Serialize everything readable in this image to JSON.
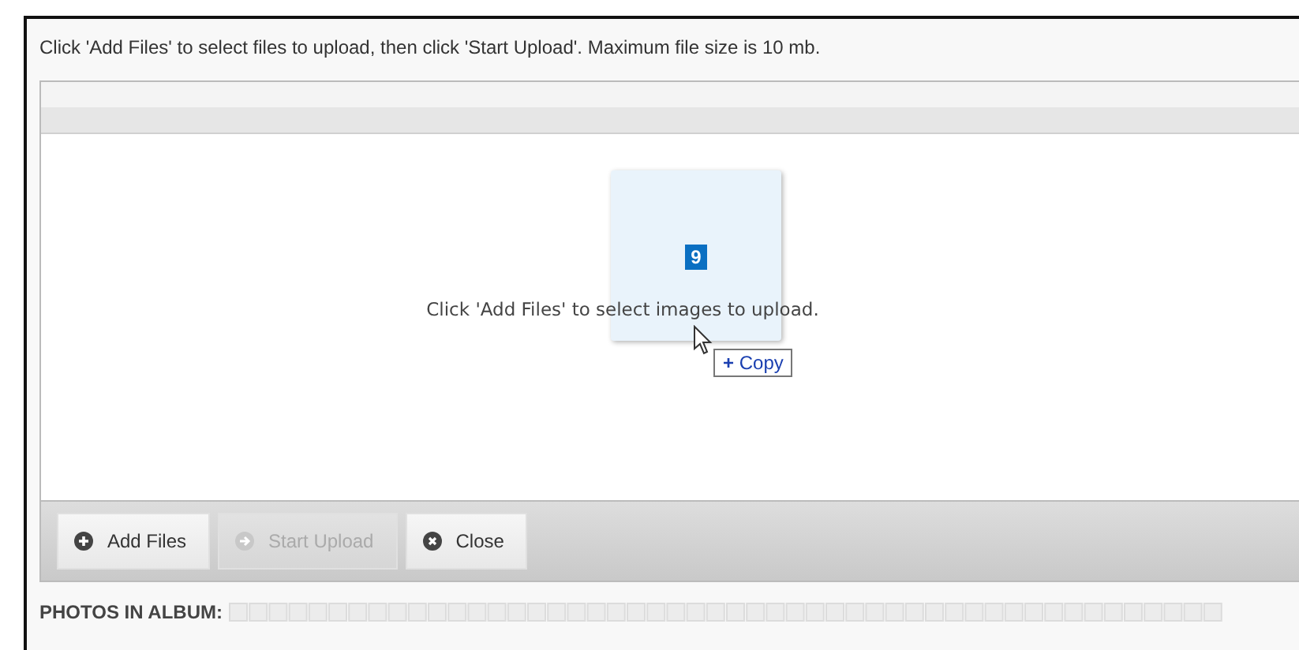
{
  "instructions": "Click 'Add Files' to select files to upload, then click 'Start Upload'. Maximum file size is 10 mb.",
  "drop_area": {
    "message": "Click 'Add Files' to select images to upload.",
    "drag_badge": "9",
    "drag_tooltip": {
      "symbol": "+",
      "label": "Copy"
    }
  },
  "buttons": [
    {
      "label": "Add Files",
      "kind": "add",
      "disabled": false
    },
    {
      "label": "Start Upload",
      "kind": "start",
      "disabled": true
    },
    {
      "label": "Close",
      "kind": "close",
      "disabled": false
    }
  ],
  "album": {
    "label": "PHOTOS IN ALBUM:"
  }
}
